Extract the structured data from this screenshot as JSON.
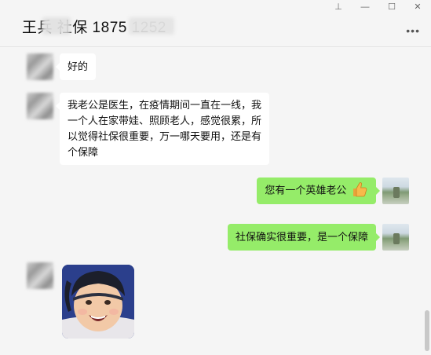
{
  "header": {
    "title": "王兵 社保 1875 1252",
    "window_controls": [
      "⊥",
      "—",
      "☐",
      "✕"
    ],
    "more_icon": "more-horizontal-icon"
  },
  "messages": [
    {
      "direction": "in",
      "text_lines": [
        "好的"
      ]
    },
    {
      "direction": "in",
      "text_lines": [
        "我老公是医生，在疫情期间一直在一线，我",
        "一个人在家带娃、照顾老人，感觉很累，所",
        "以觉得社保很重要，万一哪天要用，还是有",
        "个保障"
      ]
    },
    {
      "direction": "out",
      "text_lines": [
        "您有一个英雄老公"
      ],
      "emoji": "thumbs-up-icon"
    },
    {
      "direction": "out",
      "text_lines": [
        "社保确实很重要，是一个保障"
      ]
    },
    {
      "direction": "in",
      "type": "image",
      "image": "baby-photo"
    }
  ],
  "colors": {
    "background": "#f5f5f5",
    "incoming_bubble": "#ffffff",
    "outgoing_bubble": "#95ec69"
  }
}
